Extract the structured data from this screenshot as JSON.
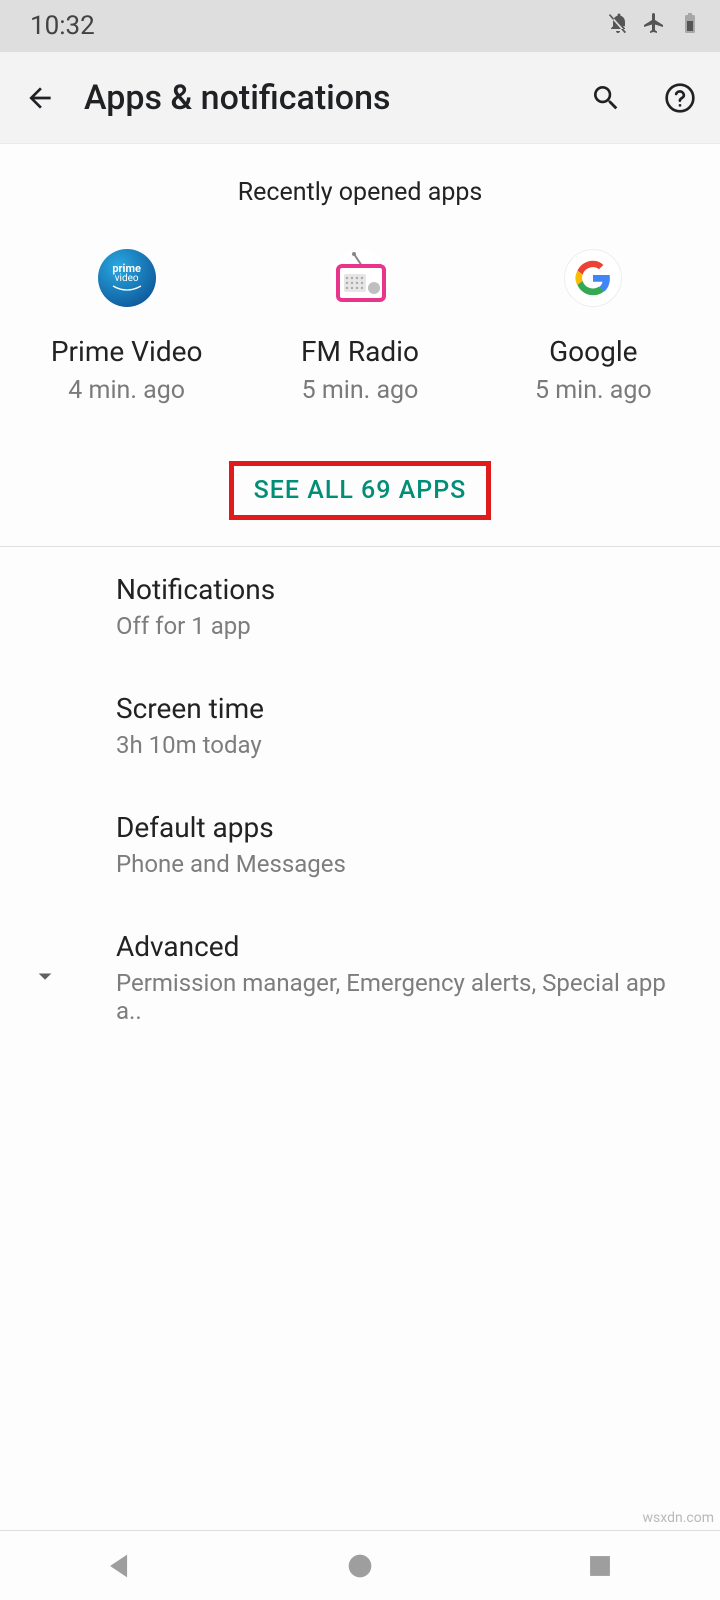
{
  "status": {
    "time": "10:32"
  },
  "header": {
    "title": "Apps & notifications"
  },
  "recent": {
    "section_title": "Recently opened apps",
    "apps": [
      {
        "name": "Prime Video",
        "time": "4 min. ago"
      },
      {
        "name": "FM Radio",
        "time": "5 min. ago"
      },
      {
        "name": "Google",
        "time": "5 min. ago"
      }
    ],
    "see_all": "SEE ALL 69 APPS"
  },
  "settings": [
    {
      "title": "Notifications",
      "sub": "Off for 1 app"
    },
    {
      "title": "Screen time",
      "sub": "3h 10m today"
    },
    {
      "title": "Default apps",
      "sub": "Phone and Messages"
    },
    {
      "title": "Advanced",
      "sub": "Permission manager, Emergency alerts, Special app a.."
    }
  ],
  "watermark": "wsxdn.com"
}
